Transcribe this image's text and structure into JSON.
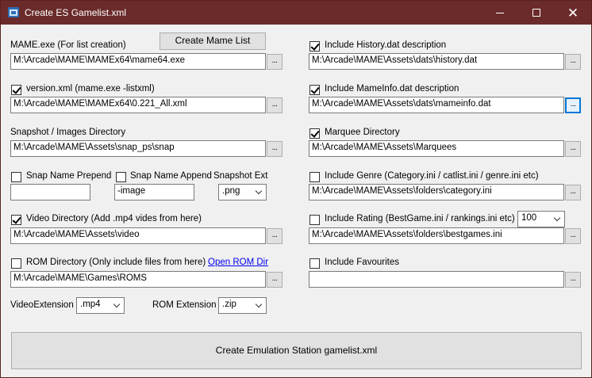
{
  "window": {
    "title": "Create ES Gamelist.xml",
    "minimize_glyph": "",
    "close_glyph": "✕"
  },
  "left": {
    "mame_exe": {
      "label": "MAME.exe (For list creation)",
      "value": "M:\\Arcade\\MAME\\MAMEx64\\mame64.exe",
      "browse": "..."
    },
    "create_mame_list_button": "Create Mame List",
    "version_xml": {
      "label": "version.xml (mame.exe -listxml)",
      "checked": true,
      "value": "M:\\Arcade\\MAME\\MAMEx64\\0.221_All.xml",
      "browse": "..."
    },
    "snapshot_dir": {
      "label": "Snapshot / Images Directory",
      "value": "M:\\Arcade\\MAME\\Assets\\snap_ps\\snap",
      "browse": "..."
    },
    "snap_prepend": {
      "label": "Snap Name Prepend",
      "checked": false,
      "value": ""
    },
    "snap_append": {
      "label": "Snap Name Append",
      "checked": false,
      "value": "-image"
    },
    "snapshot_ext": {
      "label": "Snapshot Ext",
      "value": ".png"
    },
    "video_dir": {
      "label": "Video Directory  (Add .mp4 vides from here)",
      "checked": true,
      "value": "M:\\Arcade\\MAME\\Assets\\video",
      "browse": "..."
    },
    "rom_dir": {
      "label": "ROM Directory (Only include files from here)",
      "checked": false,
      "link": "Open ROM Dir",
      "value": "M:\\Arcade\\MAME\\Games\\ROMS",
      "browse": "..."
    },
    "video_extension": {
      "label": "VideoExtension",
      "value": ".mp4"
    },
    "rom_extension": {
      "label": "ROM Extension",
      "value": ".zip"
    }
  },
  "right": {
    "history": {
      "label": "Include History.dat description",
      "checked": true,
      "value": "M:\\Arcade\\MAME\\Assets\\dats\\history.dat",
      "browse": "..."
    },
    "mameinfo": {
      "label": "Include MameInfo.dat description",
      "checked": true,
      "value": "M:\\Arcade\\MAME\\Assets\\dats\\mameinfo.dat",
      "browse": "..."
    },
    "marquee": {
      "label": "Marquee Directory",
      "checked": true,
      "value": "M:\\Arcade\\MAME\\Assets\\Marquees",
      "browse": "..."
    },
    "genre": {
      "label": "Include Genre (Category.ini / catlist.ini / genre.ini etc)",
      "checked": false,
      "value": "M:\\Arcade\\MAME\\Assets\\folders\\category.ini",
      "browse": "..."
    },
    "rating": {
      "label": "Include Rating (BestGame.ini / rankings.ini etc)",
      "checked": false,
      "combo_value": "100",
      "value": "M:\\Arcade\\MAME\\Assets\\folders\\bestgames.ini",
      "browse": "..."
    },
    "favourites": {
      "label": "Include Favourites",
      "checked": false,
      "value": "",
      "browse": "..."
    }
  },
  "main_button": "Create Emulation Station gamelist.xml"
}
